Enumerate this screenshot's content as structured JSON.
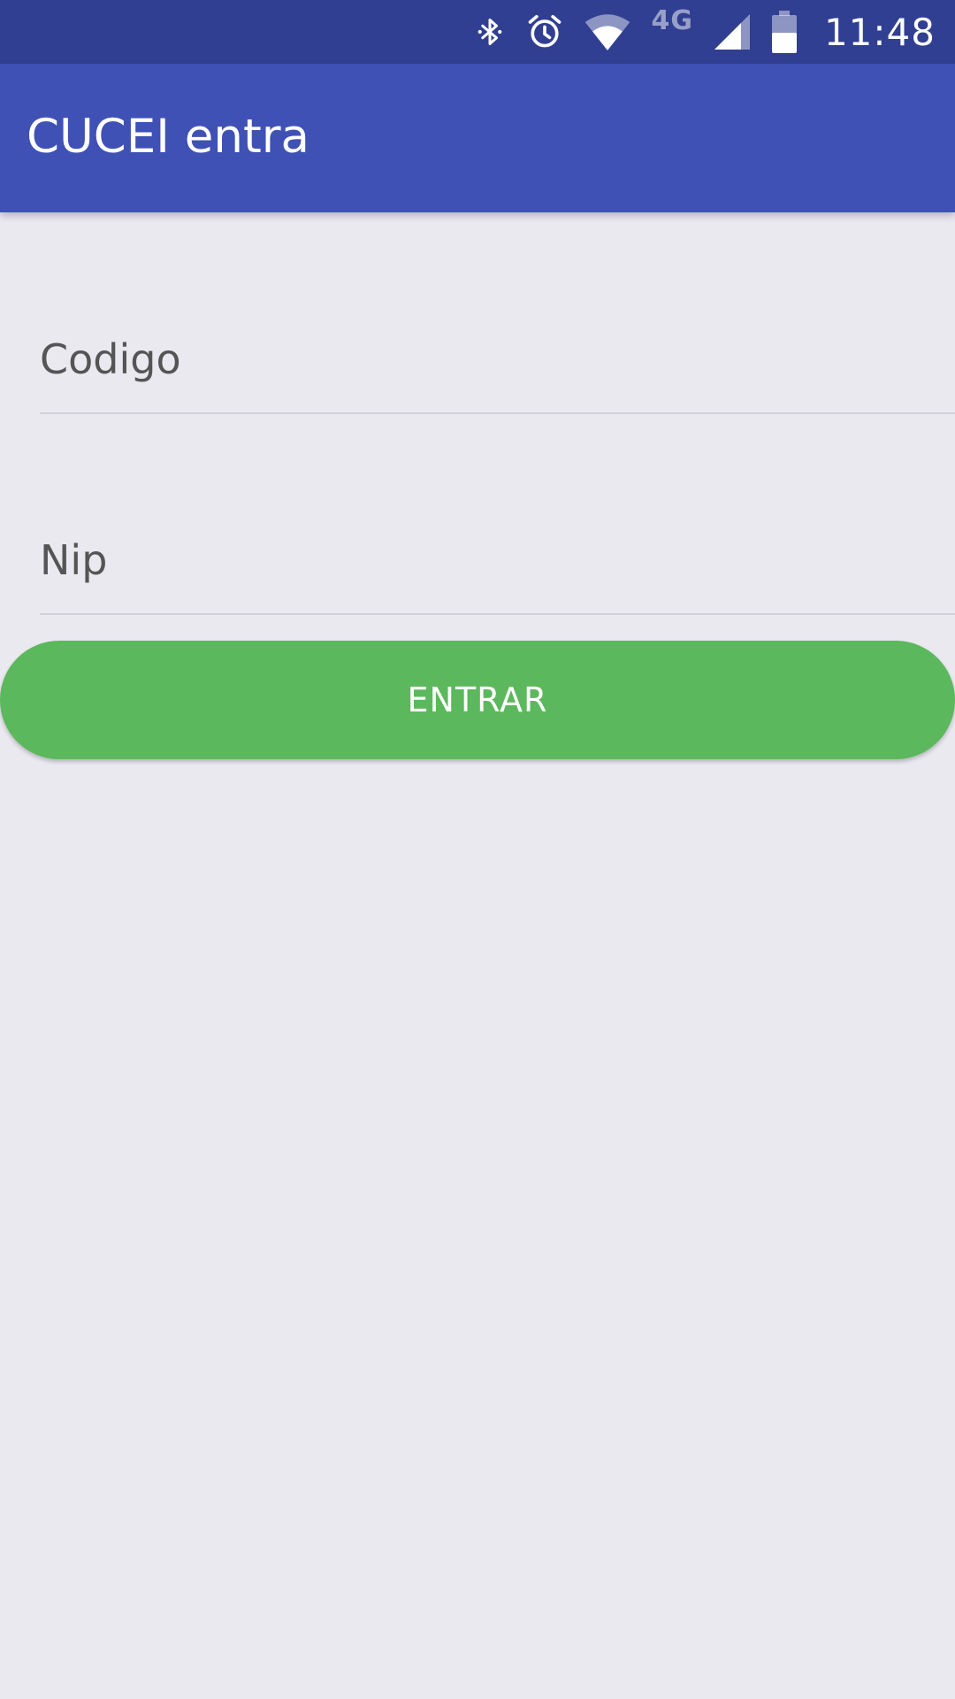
{
  "status_bar": {
    "time": "11:48",
    "network": "4G",
    "icons": [
      "bluetooth-icon",
      "alarm-icon",
      "wifi-icon",
      "cell-signal-icon",
      "battery-icon"
    ]
  },
  "app_bar": {
    "title": "CUCEI entra"
  },
  "form": {
    "codigo": {
      "placeholder": "Codigo",
      "value": ""
    },
    "nip": {
      "placeholder": "Nip",
      "value": ""
    },
    "submit_label": "ENTRAR"
  },
  "colors": {
    "status_bar": "#303f92",
    "app_bar": "#3f51b5",
    "background": "#eae9f0",
    "button": "#5cb85c"
  }
}
